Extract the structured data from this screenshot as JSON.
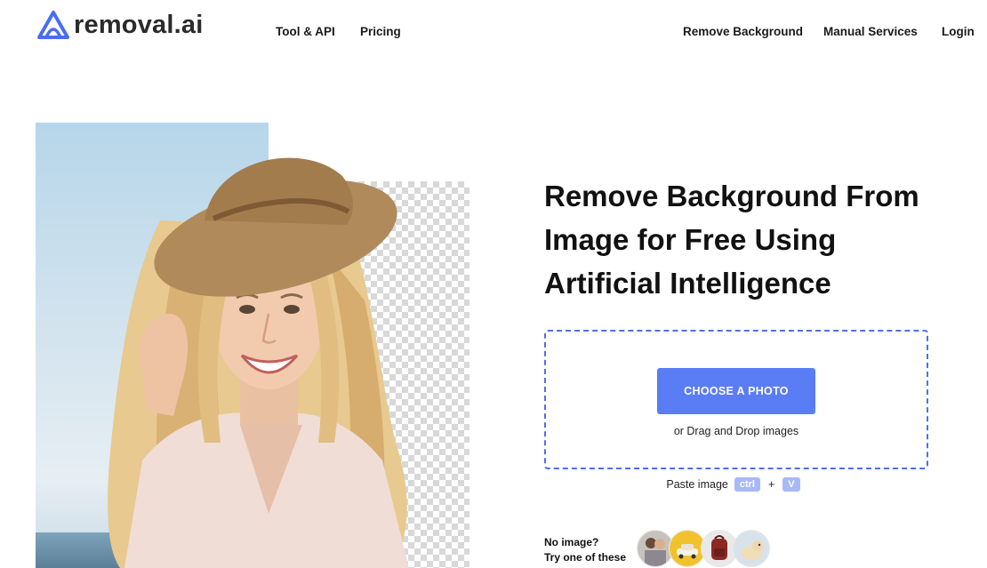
{
  "header": {
    "logo_text": "removal.ai",
    "nav_left": [
      "Tool & API",
      "Pricing"
    ],
    "nav_right": [
      "Remove Background",
      "Manual Services",
      "Login"
    ]
  },
  "hero": {
    "headline_lines": [
      "Remove Background From",
      "Image for Free Using",
      "Artificial Intelligence"
    ]
  },
  "upload": {
    "button_label": "CHOOSE A PHOTO",
    "drag_text": "or Drag and Drop images",
    "paste_label": "Paste image",
    "key_ctrl": "ctrl",
    "plus": "+",
    "key_v": "V"
  },
  "samples": {
    "line1": "No image?",
    "line2": "Try one of these",
    "items": [
      "couple-photo-icon",
      "car-photo-icon",
      "backpack-photo-icon",
      "dog-photo-icon"
    ]
  },
  "colors": {
    "accent": "#5a7cf5",
    "dropzone_border": "#4f6ef2",
    "kbd_bg": "#a7b9f7",
    "logo_blue": "#4a6cf7"
  }
}
